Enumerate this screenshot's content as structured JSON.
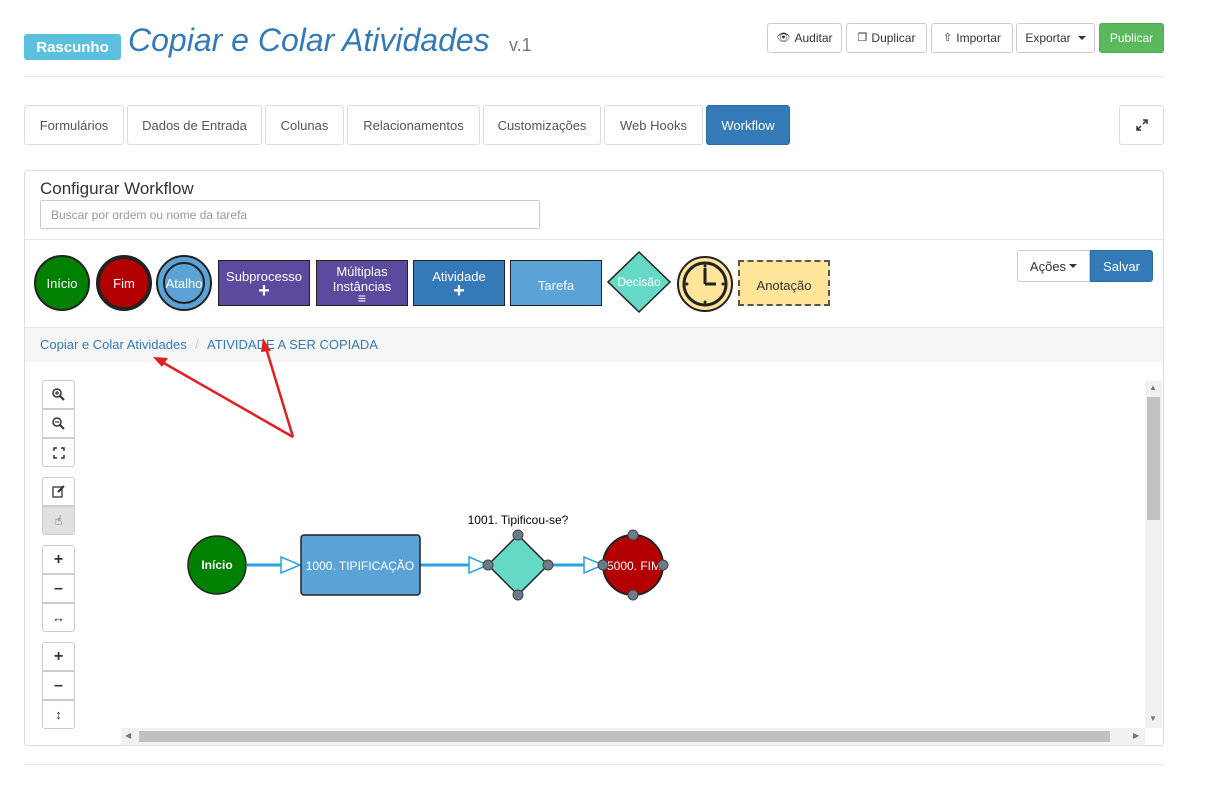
{
  "header": {
    "status_badge": "Rascunho",
    "title": "Copiar e Colar Atividades",
    "version": "v.1",
    "buttons": {
      "audit": "Auditar",
      "duplicate": "Duplicar",
      "import": "Importar",
      "export": "Exportar",
      "publish": "Publicar"
    }
  },
  "tabs": [
    "Formulários",
    "Dados de Entrada",
    "Colunas",
    "Relacionamentos",
    "Customizações",
    "Web Hooks",
    "Workflow"
  ],
  "active_tab": "Workflow",
  "workflow": {
    "title": "Configurar Workflow",
    "search_placeholder": "Buscar por ordem ou nome da tarefa",
    "palette": {
      "start": "Início",
      "end": "Fim",
      "shortcut": "Atalho",
      "subprocess": "Subprocesso",
      "multi_line1": "Múltiplas",
      "multi_line2": "Instâncias",
      "activity": "Atividade",
      "task": "Tarefa",
      "decision": "Decisão",
      "annotation": "Anotação"
    },
    "actions_label": "Ações",
    "save_label": "Salvar",
    "breadcrumb": [
      "Copiar e Colar Atividades",
      "ATIVIDADE A SER COPIADA"
    ],
    "diagram": {
      "start": "Início",
      "activity": "1000. TIPIFICAÇÃO",
      "decision": "1001. Tipificou-se?",
      "end": "5000. FIM"
    }
  },
  "colors": {
    "primary": "#337ab7",
    "success": "#5cb85c",
    "info": "#5bc0de",
    "start_green": "#008000",
    "end_red": "#b30000",
    "subprocess_purple": "#5b4a9e",
    "task_blue": "#5ba3d6",
    "decision_teal": "#66d9c6",
    "annotation_yellow": "#ffe599",
    "connector": "#29a3e0",
    "annotation_arrow": "#e02020"
  }
}
